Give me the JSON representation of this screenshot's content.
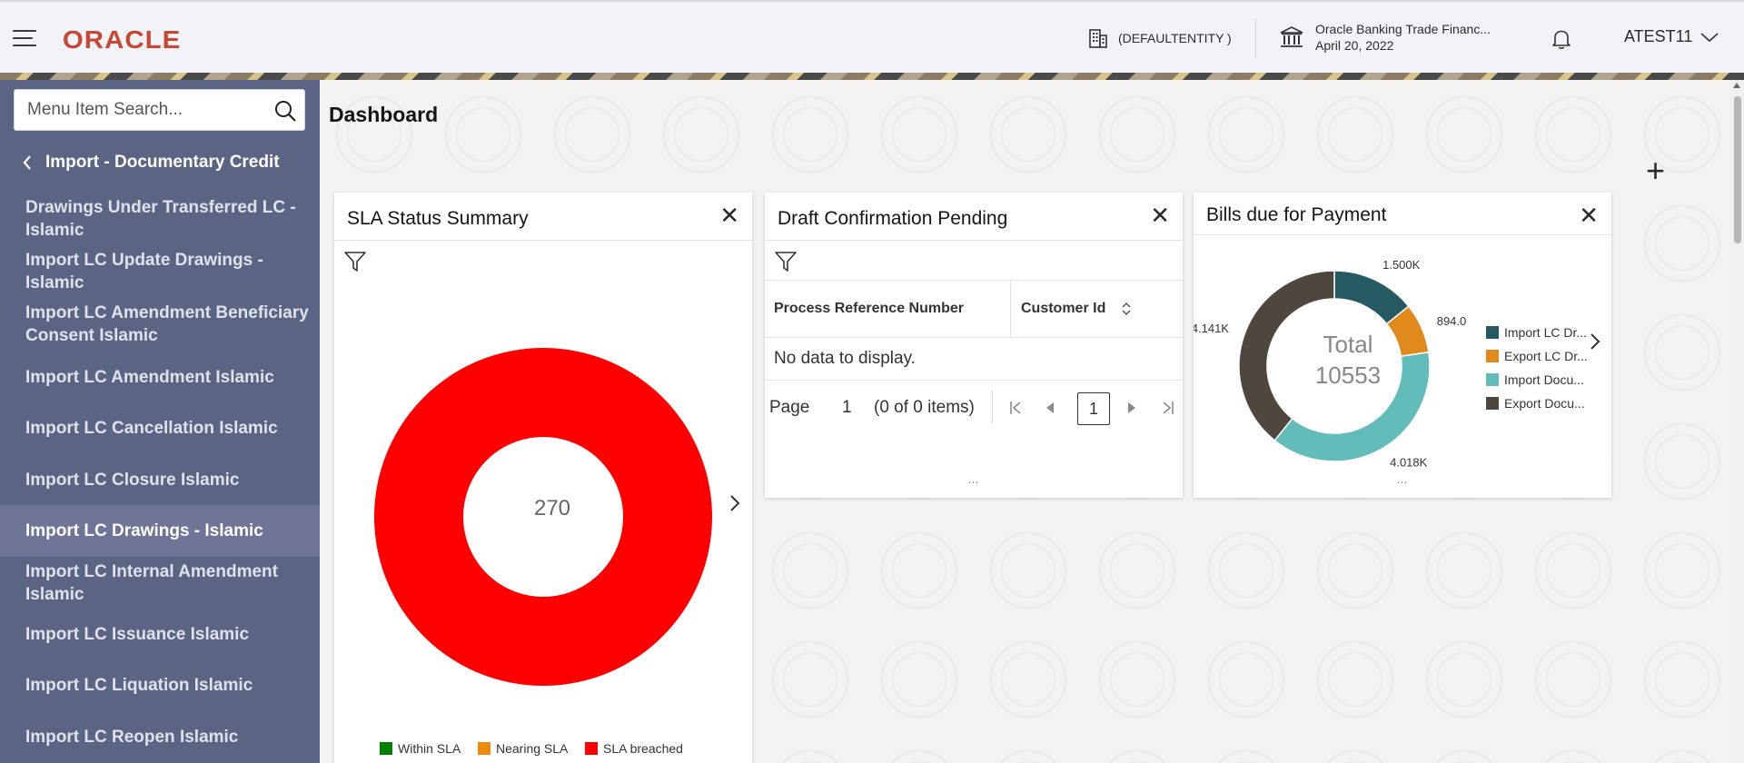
{
  "header": {
    "logo": "ORACLE",
    "entity": "(DEFAULTENTITY )",
    "bank_name": "Oracle Banking Trade Financ...",
    "date": "April 20, 2022",
    "user": "ATEST11",
    "icons": [
      "hamburger-icon",
      "building-icon",
      "bank-icon",
      "bell-icon",
      "chevron-down-icon"
    ]
  },
  "sidebar": {
    "search_placeholder": "Menu Item Search...",
    "back_label": "Import - Documentary Credit",
    "items": [
      {
        "label": "Drawings Under Transferred LC - Islamic",
        "active": false
      },
      {
        "label": "Import LC Update Drawings - Islamic",
        "active": false
      },
      {
        "label": "Import LC Amendment Beneficiary Consent Islamic",
        "active": false
      },
      {
        "label": "Import LC Amendment Islamic",
        "active": false
      },
      {
        "label": "Import LC Cancellation Islamic",
        "active": false
      },
      {
        "label": "Import LC Closure Islamic",
        "active": false
      },
      {
        "label": "Import LC Drawings - Islamic",
        "active": true
      },
      {
        "label": "Import LC Internal Amendment Islamic",
        "active": false
      },
      {
        "label": "Import LC Issuance Islamic",
        "active": false
      },
      {
        "label": "Import LC Liquation Islamic",
        "active": false
      },
      {
        "label": "Import LC Reopen Islamic",
        "active": false
      }
    ]
  },
  "main": {
    "title": "Dashboard",
    "add_label": "+"
  },
  "sla_card": {
    "title": "SLA Status Summary",
    "close": "✕",
    "center_value": "270",
    "legend": [
      {
        "label": "Within SLA",
        "color": "#008000"
      },
      {
        "label": "Nearing SLA",
        "color": "#ee8a0e"
      },
      {
        "label": "SLA breached",
        "color": "#ff0000"
      }
    ]
  },
  "draft_card": {
    "title": "Draft Confirmation Pending",
    "close": "✕",
    "columns": [
      "Process Reference Number",
      "Customer Id"
    ],
    "no_data": "No data to display.",
    "page_label": "Page",
    "page_value": "1",
    "items_info": "(0 of 0 items)",
    "current_page": "1"
  },
  "bills_card": {
    "title": "Bills due for Payment",
    "close": "✕",
    "total_label": "Total",
    "total_value": "10553",
    "data_labels": [
      "1.500K",
      "894.0",
      "4.018K",
      "4.141K"
    ],
    "legend": [
      "Import LC Dr...",
      "Export LC Dr...",
      "Import Docu...",
      "Export Docu..."
    ]
  },
  "chart_data": [
    {
      "type": "pie",
      "title": "SLA Status Summary",
      "categories": [
        "Within SLA",
        "Nearing SLA",
        "SLA breached"
      ],
      "values": [
        0,
        0,
        270
      ],
      "colors": [
        "#008000",
        "#ee8a0e",
        "#ff0000"
      ],
      "center_label": "270",
      "legend_position": "bottom"
    },
    {
      "type": "pie",
      "title": "Bills due for Payment",
      "categories": [
        "Import LC Dr...",
        "Export LC Dr...",
        "Import Docu...",
        "Export Docu..."
      ],
      "values": [
        1500,
        894,
        4018,
        4141
      ],
      "value_labels": [
        "1.500K",
        "894.0",
        "4.018K",
        "4.141K"
      ],
      "colors": [
        "#255a63",
        "#e08a1e",
        "#62bcb9",
        "#4f463d"
      ],
      "center_label": "Total 10553",
      "legend_position": "right"
    }
  ]
}
